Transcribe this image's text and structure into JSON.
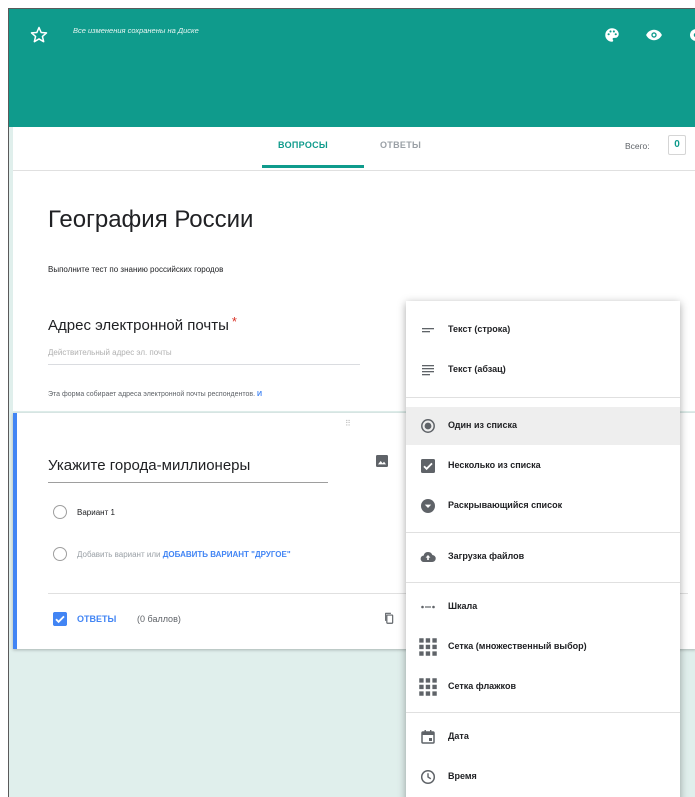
{
  "header": {
    "save_status": "Все изменения сохранены на Диске",
    "icons": [
      "star-icon",
      "palette-icon",
      "eye-icon",
      "settings-icon"
    ],
    "bg_color": "#0f9b8c"
  },
  "tabs": {
    "questions": "ВОПРОСЫ",
    "answers": "ОТВЕТЫ",
    "total_label": "Всего:",
    "total_value": "0"
  },
  "form": {
    "title": "География России",
    "description": "Выполните тест по знанию российских городов",
    "email_title": "Адрес электронной почты",
    "required_mark": "*",
    "email_placeholder": "Действительный адрес эл. почты",
    "email_note": "Эта форма собирает адреса электронной почты респондентов.",
    "email_note_link": "И"
  },
  "question": {
    "drag_handle": "⠿",
    "title": "Укажите города-миллионеры",
    "option1": "Вариант 1",
    "add_option": "Добавить вариант",
    "or": "или",
    "add_other": "ДОБАВИТЬ ВАРИАНТ \"ДРУГОЕ\"",
    "answers_label": "ОТВЕТЫ",
    "points": "(0 баллов)"
  },
  "type_menu": {
    "items": [
      {
        "label": "Текст (строка)",
        "icon": "short-text-icon"
      },
      {
        "label": "Текст (абзац)",
        "icon": "paragraph-icon"
      },
      {
        "label": "Один из списка",
        "icon": "radio-icon",
        "selected": true
      },
      {
        "label": "Несколько из списка",
        "icon": "checkbox-icon"
      },
      {
        "label": "Раскрывающийся список",
        "icon": "dropdown-icon"
      },
      {
        "label": "Загрузка файлов",
        "icon": "cloud-upload-icon"
      },
      {
        "label": "Шкала",
        "icon": "linear-scale-icon"
      },
      {
        "label": "Сетка (множественный выбор)",
        "icon": "grid-icon"
      },
      {
        "label": "Сетка флажков",
        "icon": "checkbox-grid-icon"
      },
      {
        "label": "Дата",
        "icon": "calendar-icon"
      },
      {
        "label": "Время",
        "icon": "clock-icon"
      }
    ]
  }
}
